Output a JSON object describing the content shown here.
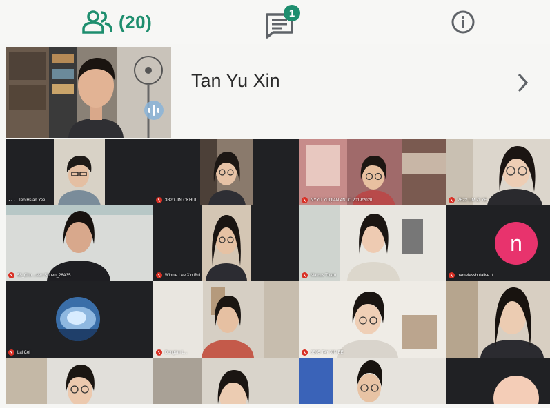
{
  "toolbar": {
    "participant_count": "(20)",
    "chat_unread_count": "1",
    "accent_color": "#1e8e6e",
    "icons": [
      "people-icon",
      "chat-icon",
      "info-icon"
    ]
  },
  "presenter": {
    "name": "Tan Yu Xin"
  },
  "tiles": [
    {
      "label": "Teo Hsian Yee",
      "muted": false
    },
    {
      "label": "3B20 JIN OKHUI",
      "muted": true
    },
    {
      "label": "NYYU YUQIAN 4NUC 2019/2020",
      "muted": true
    },
    {
      "label": "2B22 LIM ZI YE",
      "muted": true
    },
    {
      "label": "58_Chu ...een Shuen_26A35",
      "muted": true
    },
    {
      "label": "Winnie Lee Xin Rui",
      "muted": true
    },
    {
      "label": "Marcus Tharu",
      "muted": true
    },
    {
      "label": "namelessbutalive :/",
      "muted": true
    },
    {
      "label": "Lai Cel",
      "muted": true
    },
    {
      "label": "Dongtan L...",
      "muted": true
    },
    {
      "label": "3B05 TAY XIN EE",
      "muted": true
    },
    {
      "label": "",
      "muted": false
    },
    {
      "label": "",
      "muted": false
    },
    {
      "label": "",
      "muted": false
    },
    {
      "label": "",
      "muted": false
    },
    {
      "label": "",
      "muted": false
    }
  ],
  "avatar_letter": "n",
  "avatar_color": "#e8336d"
}
